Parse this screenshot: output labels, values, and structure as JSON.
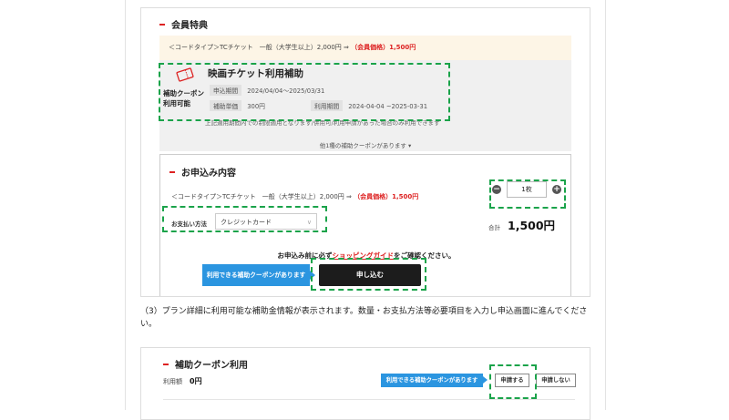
{
  "shot1": {
    "section_title": "会員特典",
    "notice": {
      "text": "＜コードタイプ＞TCチケット　一般（大学生以上）2,000円 ⇒ ",
      "member_price": "（会員価格）1,500円"
    },
    "coupon": {
      "label": "補助クーポン 利用可能",
      "title": "映画チケット利用補助",
      "apply_period_label": "申込期間",
      "apply_period": "2024/04/04～2025/03/31",
      "unit_price_label": "補助単価",
      "unit_price": "300円",
      "use_period_label": "利用期間",
      "use_period": "2024-04-04 ~2025-03-31",
      "note": "上記適用期間内での制限適用となります/併用可/利用申請があった場合のみ利用できます",
      "more": "他1種の補助クーポンがあります ▾"
    },
    "order": {
      "section_title": "お申込み内容",
      "item_text": "＜コードタイプ＞TCチケット　一般（大学生以上）2,000円 ⇒ ",
      "member_price": "（会員価格）1,500円",
      "quantity": "1枚",
      "minus": "−",
      "plus": "+",
      "payment_label": "お支払い方法",
      "payment_value": "クレジットカード",
      "total_label": "合計",
      "total_value": "1,500円",
      "guide_before": "お申込み前に必ず",
      "guide_link": "ショッピングガイド",
      "guide_after": "をご確認ください。",
      "coupon_button": "利用できる補助クーポンがあります",
      "apply_button": "申し込む"
    }
  },
  "caption": "（3）プラン詳細に利用可能な補助金情報が表示されます。数量・お支払方法等必要項目を入力し申込画面に進んでください。",
  "shot2": {
    "section_title": "補助クーポン利用",
    "amount_label": "利用額",
    "amount_value": "0円",
    "coupon_button": "利用できる補助クーポンがあります",
    "apply_button": "申請する",
    "no_apply_button": "申請しない"
  },
  "colors": {
    "accent_red": "#d22222",
    "button_blue": "#2b95e0",
    "highlight_green": "#1aa34a",
    "apply_black": "#1c1c1c"
  }
}
